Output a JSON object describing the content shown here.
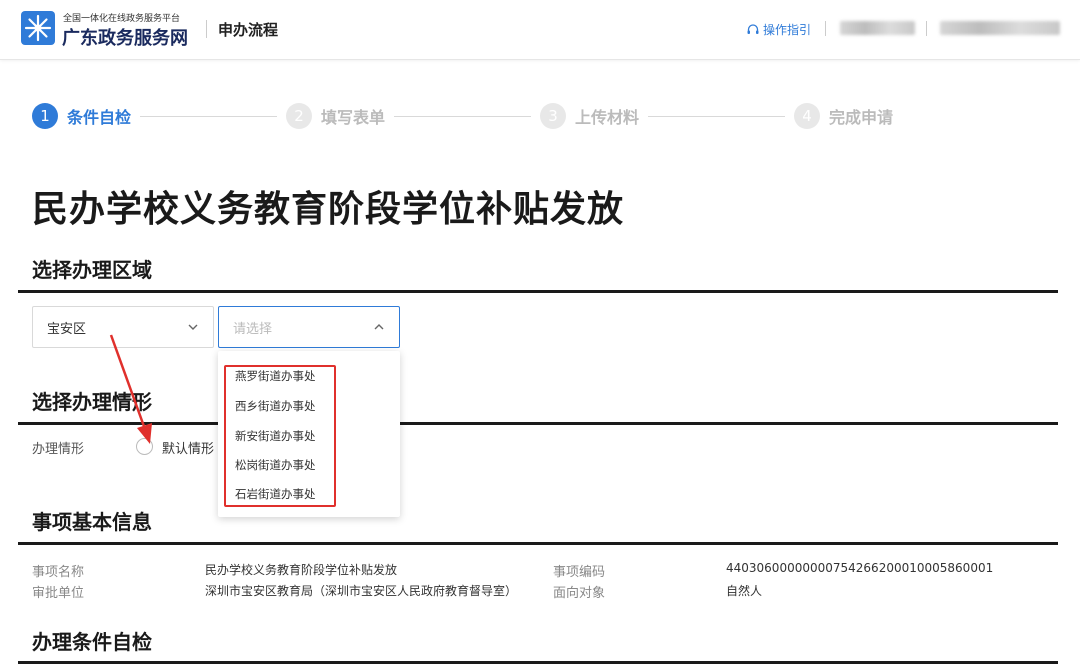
{
  "header": {
    "logo_subtitle": "全国一体化在线政务服务平台",
    "logo_title": "广东政务服务网",
    "page_section": "申办流程",
    "guide_label": "操作指引",
    "brand_color": "#2f7bd8"
  },
  "steps": [
    {
      "number": "1",
      "label": "条件自检",
      "active": true
    },
    {
      "number": "2",
      "label": "填写表单",
      "active": false
    },
    {
      "number": "3",
      "label": "上传材料",
      "active": false
    },
    {
      "number": "4",
      "label": "完成申请",
      "active": false
    }
  ],
  "page_title": "民办学校义务教育阶段学位补贴发放",
  "region_section": {
    "title": "选择办理区域",
    "district_value": "宝安区",
    "street_placeholder": "请选择",
    "street_options": [
      "燕罗街道办事处",
      "西乡街道办事处",
      "新安街道办事处",
      "松岗街道办事处",
      "石岩街道办事处"
    ]
  },
  "situation_section": {
    "title": "选择办理情形",
    "field_label": "办理情形",
    "option_label": "默认情形"
  },
  "basic_info": {
    "title": "事项基本信息",
    "item_name_label": "事项名称",
    "item_name_value": "民办学校义务教育阶段学位补贴发放",
    "item_code_label": "事项编码",
    "item_code_value": "44030600000000754266200010005860001",
    "approval_unit_label": "审批单位",
    "approval_unit_value": "深圳市宝安区教育局（深圳市宝安区人民政府教育督导室）",
    "target_label": "面向对象",
    "target_value": "自然人"
  },
  "self_check_section": {
    "title": "办理条件自检"
  },
  "annotation_color": "#e0302c"
}
